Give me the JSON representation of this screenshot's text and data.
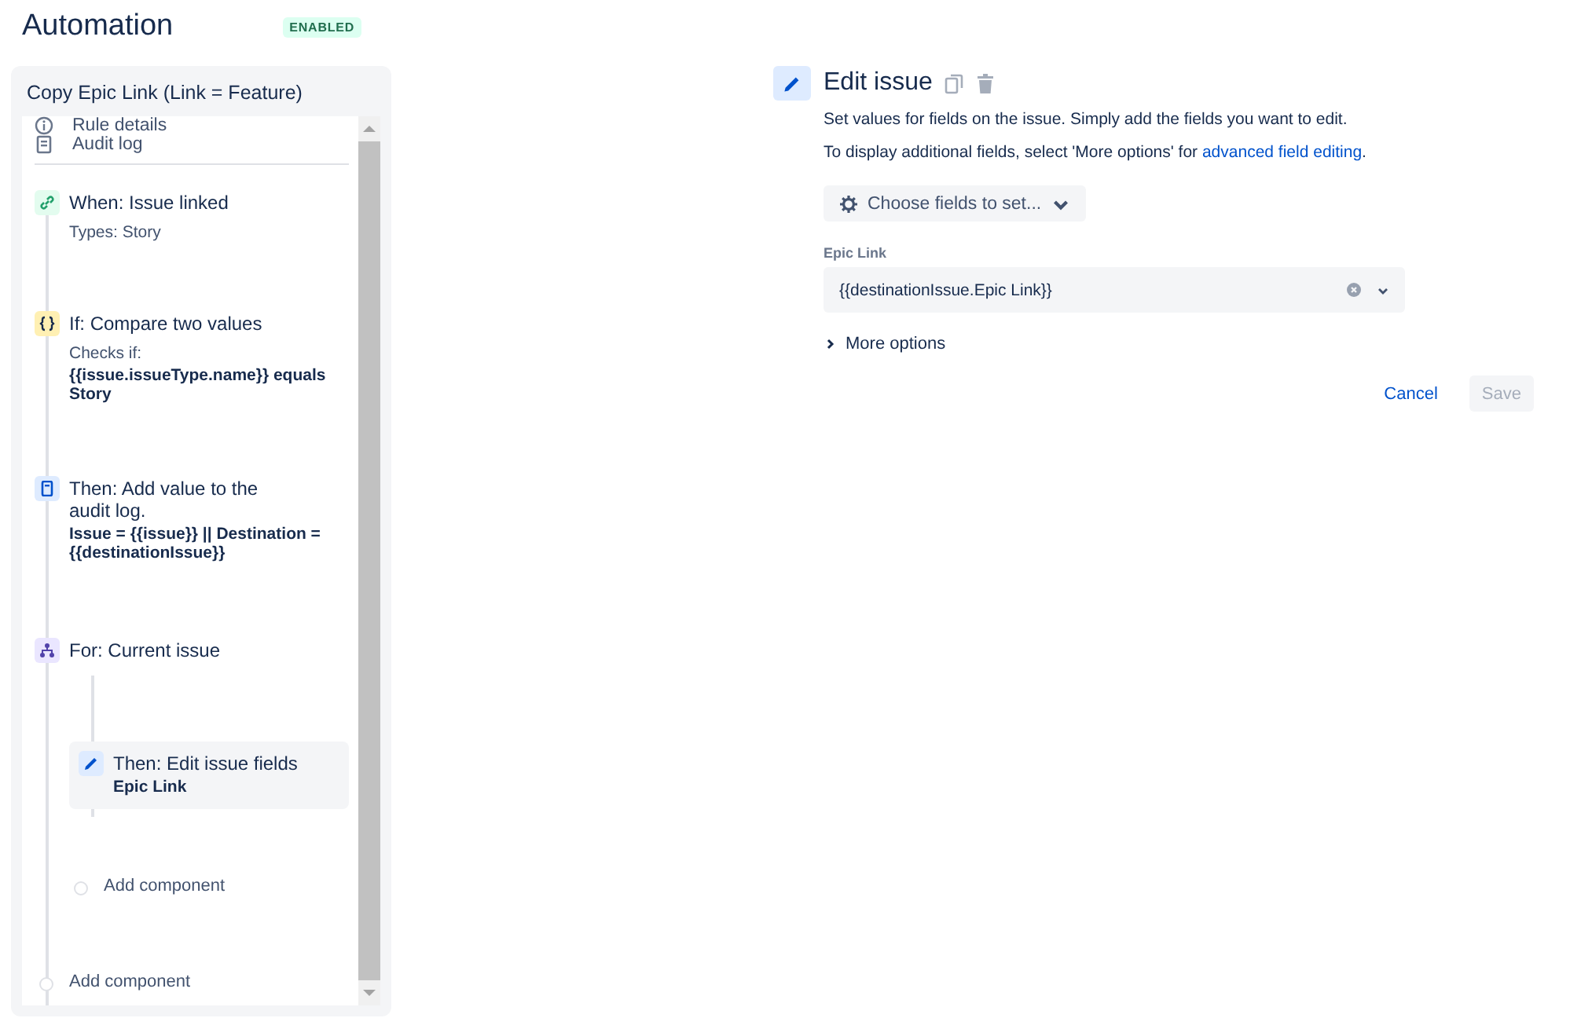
{
  "page": {
    "title": "Automation",
    "status_badge": "ENABLED"
  },
  "rule": {
    "name": "Copy Epic Link (Link = Feature)",
    "menu": [
      {
        "label": "Rule details",
        "kind": "info"
      },
      {
        "label": "Audit log",
        "kind": "log"
      }
    ],
    "steps": [
      {
        "kind": "trigger",
        "title": "When: Issue linked",
        "detail": "Types: Story",
        "selected": false
      },
      {
        "kind": "condition",
        "title": "If: Compare two values",
        "detail": "Checks if:",
        "value": "{{issue.issueType.name}} equals Story",
        "selected": false
      },
      {
        "kind": "log",
        "title": "Then: Add value to the audit log.",
        "value": "Issue = {{issue}} || Destination = {{destinationIssue}}",
        "selected": false
      },
      {
        "kind": "branch",
        "title": "For: Current issue",
        "selected": false,
        "children": [
          {
            "kind": "edit",
            "title": "Then: Edit issue fields",
            "value": "Epic Link",
            "selected": true
          },
          {
            "kind": "add",
            "title": "Add component",
            "selected": false
          }
        ]
      },
      {
        "kind": "add",
        "title": "Add component",
        "selected": false
      }
    ]
  },
  "editor": {
    "title": "Edit issue",
    "description": "Set values for fields on the issue. Simply add the fields you want to edit.",
    "hint": "To display additional fields, select 'More options' for ",
    "hint_link": "advanced field editing",
    "hint_end": ".",
    "choose_button": "Choose fields to set...",
    "field": {
      "label": "Epic Link",
      "value": "{{destinationIssue.Epic Link}}"
    },
    "more_options": {
      "label": "More options",
      "expanded": false
    },
    "buttons": [
      {
        "label": "Cancel",
        "kind": "link",
        "disabled": false
      },
      {
        "label": "Save",
        "kind": "primary",
        "disabled": true
      }
    ]
  }
}
